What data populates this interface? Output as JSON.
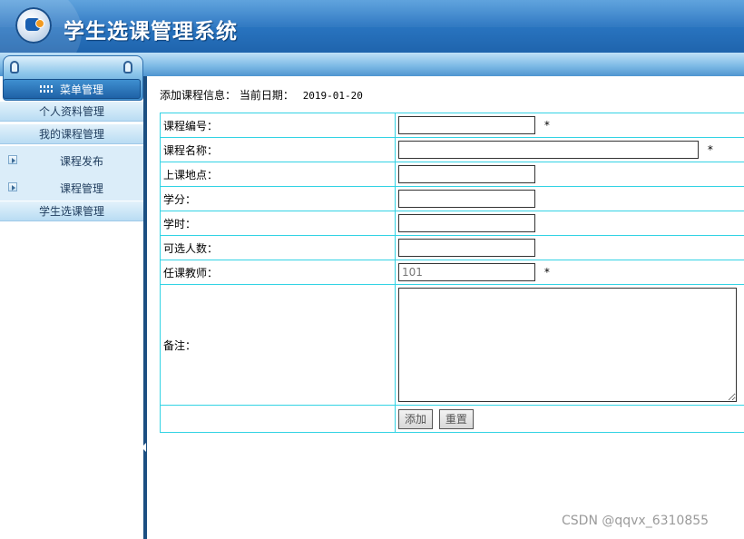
{
  "header": {
    "title": "学生选课管理系统"
  },
  "sidebar": {
    "menu_header": "菜单管理",
    "items": [
      {
        "label": "个人资料管理"
      },
      {
        "label": "我的课程管理"
      }
    ],
    "sub_items": [
      {
        "label": "课程发布"
      },
      {
        "label": "课程管理"
      }
    ],
    "after_items": [
      {
        "label": "学生选课管理"
      }
    ]
  },
  "content": {
    "info_label": "添加课程信息：",
    "date_label": "当前日期：",
    "date_value": "2019-01-20",
    "form": {
      "course_no_label": "课程编号：",
      "course_name_label": "课程名称：",
      "location_label": "上课地点：",
      "credit_label": "学分：",
      "hours_label": "学时：",
      "capacity_label": "可选人数：",
      "teacher_label": "任课教师：",
      "teacher_value": "101",
      "remark_label": "备注：",
      "required_mark": "*",
      "add_button": "添加",
      "reset_button": "重置"
    }
  },
  "watermark": "CSDN @qqvx_6310855"
}
